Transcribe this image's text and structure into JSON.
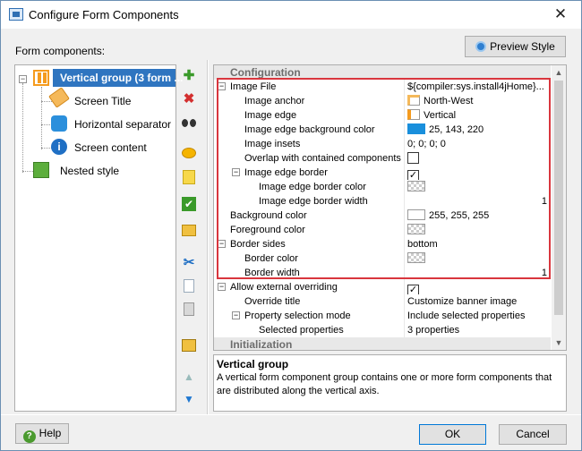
{
  "window": {
    "title": "Configure Form Components",
    "close_glyph": "✕"
  },
  "form_components_label": "Form components:",
  "preview_button": "Preview Style",
  "tree": {
    "root": {
      "label": "Vertical group (3 form ...",
      "icon": "vertical-group-icon"
    },
    "children": [
      {
        "label": "Screen Title",
        "icon": "tag-icon"
      },
      {
        "label": "Horizontal separator",
        "icon": "puzzle-icon"
      },
      {
        "label": "Screen content",
        "icon": "info-icon"
      }
    ],
    "nested": {
      "label": "Nested style",
      "icon": "nested-style-icon"
    }
  },
  "toolbar": [
    {
      "name": "add-button",
      "glyph": "✚",
      "color": "#3a9a2a"
    },
    {
      "name": "delete-button",
      "glyph": "✖",
      "color": "#d32f2f"
    },
    {
      "name": "find-button",
      "glyph": "binoculars"
    },
    {
      "name": "comment-button",
      "glyph": "comment"
    },
    {
      "name": "note-button",
      "glyph": "note"
    },
    {
      "name": "check-button",
      "glyph": "✔"
    },
    {
      "name": "folder-add-button",
      "glyph": "folder"
    },
    {
      "name": "cut-button",
      "glyph": "✂"
    },
    {
      "name": "copy-button",
      "glyph": "copy"
    },
    {
      "name": "paste-button",
      "glyph": "paste"
    },
    {
      "name": "image-button",
      "glyph": "image"
    },
    {
      "name": "move-up-button",
      "glyph": "▲"
    },
    {
      "name": "move-down-button",
      "glyph": "▼"
    }
  ],
  "properties": {
    "configuration_header": "Configuration",
    "rows": {
      "image_file": {
        "name": "Image File",
        "value": "${compiler:sys.install4jHome}..."
      },
      "image_anchor": {
        "name": "Image anchor",
        "value": "North-West"
      },
      "image_edge": {
        "name": "Image edge",
        "value": "Vertical"
      },
      "image_edge_bg": {
        "name": "Image edge background color",
        "value": "25, 143, 220",
        "color": "#198fdc"
      },
      "image_insets": {
        "name": "Image insets",
        "value": "0; 0; 0; 0"
      },
      "overlap": {
        "name": "Overlap with contained components",
        "checked": false
      },
      "edge_border": {
        "name": "Image edge border",
        "checked": true
      },
      "edge_border_color": {
        "name": "Image edge border color"
      },
      "edge_border_width": {
        "name": "Image edge border width",
        "value": "1"
      },
      "bg_color": {
        "name": "Background color",
        "value": "255, 255, 255",
        "color": "#ffffff"
      },
      "fg_color": {
        "name": "Foreground color"
      },
      "border_sides": {
        "name": "Border sides",
        "value": "bottom"
      },
      "border_color": {
        "name": "Border color"
      },
      "border_width": {
        "name": "Border width",
        "value": "1"
      },
      "allow_ext": {
        "name": "Allow external overriding",
        "checked": true
      },
      "override_title": {
        "name": "Override title",
        "value": "Customize banner image"
      },
      "prop_sel_mode": {
        "name": "Property selection mode",
        "value": "Include selected properties"
      },
      "selected_props": {
        "name": "Selected properties",
        "value": "3 properties"
      }
    },
    "initialization_header": "Initialization"
  },
  "description": {
    "title": "Vertical group",
    "text": "A vertical form component group contains one or more form components that are distributed along the vertical axis."
  },
  "buttons": {
    "help": "Help",
    "ok": "OK",
    "cancel": "Cancel"
  },
  "colors": {
    "highlight_box": "#d9363e",
    "selection": "#2f75c0"
  }
}
